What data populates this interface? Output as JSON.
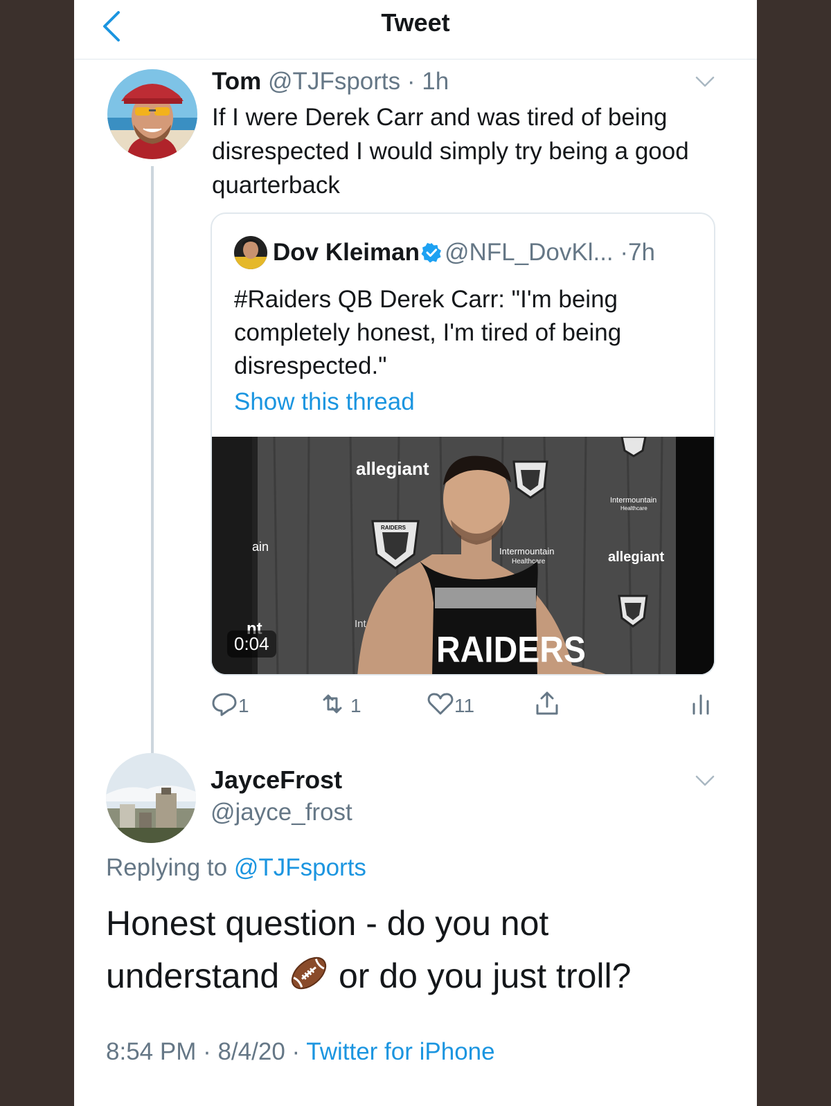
{
  "header": {
    "title": "Tweet"
  },
  "parent_tweet": {
    "name": "Tom",
    "handle": "@TJFsports",
    "sep": " · ",
    "time": "1h",
    "text": "If I were Derek Carr and was tired of being disrespected I would simply try being a good quarterback",
    "quoted": {
      "name": "Dov Kleiman",
      "handle": "@NFL_DovKl...",
      "sep": " ·",
      "time": "7h",
      "text": "#Raiders QB Derek Carr: \"I'm being completely honest, I'm tired of being disrespected.\"",
      "link": "Show this thread",
      "video_duration": "0:04",
      "video_signage": {
        "sponsor_a": "allegiant",
        "sponsor_b": "allegiant",
        "sponsor_c": "Intermountain",
        "sponsor_c_sub": "Healthcare",
        "sponsor_d": "Intermountain",
        "sponsor_d_sub": "Healthcare",
        "shirt": "RAIDERS",
        "shield": "RAIDERS",
        "left_a": "ain",
        "left_b": "nt",
        "left_c": "Int"
      }
    },
    "stats": {
      "replies": "1",
      "retweets": "1",
      "likes": "11"
    }
  },
  "reply": {
    "name": "JayceFrost",
    "handle": "@jayce_frost",
    "replying_label": "Replying to ",
    "replying_to": "@TJFsports",
    "text_before": "Honest question - do you not understand ",
    "text_after": " or do you just troll?",
    "emoji": "football-emoji",
    "time": "8:54 PM",
    "sep": " · ",
    "date": "8/4/20",
    "sep2": " · ",
    "source": "Twitter for iPhone"
  },
  "colors": {
    "accent": "#1b95e0",
    "text": "#14171a",
    "muted": "#657786",
    "border": "#e1e8ed",
    "background": "#3b302c"
  }
}
